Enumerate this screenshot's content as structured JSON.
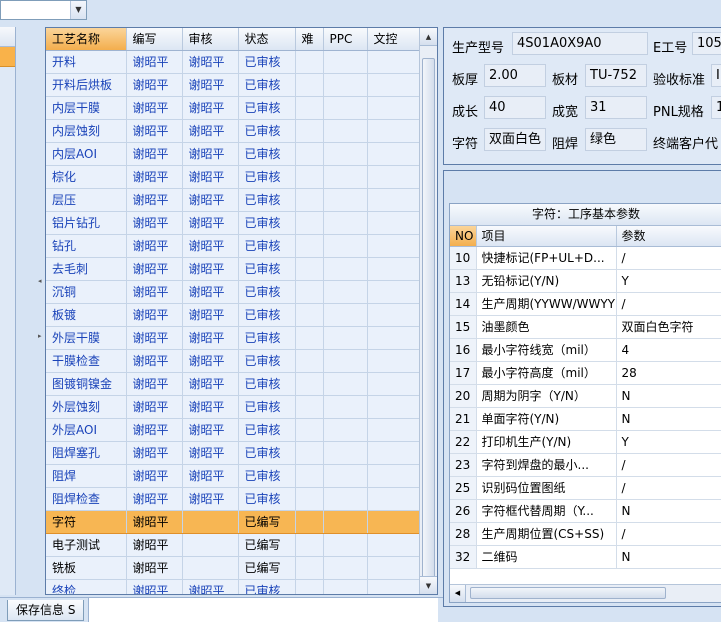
{
  "top_dropdown": {
    "value": "",
    "arrow_icon": "chevron-down-icon"
  },
  "process_grid": {
    "columns": [
      "工艺名称",
      "编写",
      "审核",
      "状态",
      "难",
      "PPC",
      "文控"
    ],
    "rows": [
      {
        "name": "开料",
        "writer": "谢昭平",
        "reviewer": "谢昭平",
        "status": "已审核"
      },
      {
        "name": "开料后烘板",
        "writer": "谢昭平",
        "reviewer": "谢昭平",
        "status": "已审核"
      },
      {
        "name": "内层干膜",
        "writer": "谢昭平",
        "reviewer": "谢昭平",
        "status": "已审核"
      },
      {
        "name": "内层蚀刻",
        "writer": "谢昭平",
        "reviewer": "谢昭平",
        "status": "已审核"
      },
      {
        "name": "内层AOI",
        "writer": "谢昭平",
        "reviewer": "谢昭平",
        "status": "已审核"
      },
      {
        "name": "棕化",
        "writer": "谢昭平",
        "reviewer": "谢昭平",
        "status": "已审核"
      },
      {
        "name": "层压",
        "writer": "谢昭平",
        "reviewer": "谢昭平",
        "status": "已审核"
      },
      {
        "name": "铝片钻孔",
        "writer": "谢昭平",
        "reviewer": "谢昭平",
        "status": "已审核"
      },
      {
        "name": "钻孔",
        "writer": "谢昭平",
        "reviewer": "谢昭平",
        "status": "已审核"
      },
      {
        "name": "去毛刺",
        "writer": "谢昭平",
        "reviewer": "谢昭平",
        "status": "已审核"
      },
      {
        "name": "沉铜",
        "writer": "谢昭平",
        "reviewer": "谢昭平",
        "status": "已审核"
      },
      {
        "name": "板镀",
        "writer": "谢昭平",
        "reviewer": "谢昭平",
        "status": "已审核"
      },
      {
        "name": "外层干膜",
        "writer": "谢昭平",
        "reviewer": "谢昭平",
        "status": "已审核"
      },
      {
        "name": "干膜检查",
        "writer": "谢昭平",
        "reviewer": "谢昭平",
        "status": "已审核"
      },
      {
        "name": "图镀铜镍金",
        "writer": "谢昭平",
        "reviewer": "谢昭平",
        "status": "已审核"
      },
      {
        "name": "外层蚀刻",
        "writer": "谢昭平",
        "reviewer": "谢昭平",
        "status": "已审核"
      },
      {
        "name": "外层AOI",
        "writer": "谢昭平",
        "reviewer": "谢昭平",
        "status": "已审核"
      },
      {
        "name": "阻焊塞孔",
        "writer": "谢昭平",
        "reviewer": "谢昭平",
        "status": "已审核"
      },
      {
        "name": "阻焊",
        "writer": "谢昭平",
        "reviewer": "谢昭平",
        "status": "已审核"
      },
      {
        "name": "阻焊检查",
        "writer": "谢昭平",
        "reviewer": "谢昭平",
        "status": "已审核"
      },
      {
        "name": "字符",
        "writer": "谢昭平",
        "reviewer": "",
        "status": "已编写"
      },
      {
        "name": "电子测试",
        "writer": "谢昭平",
        "reviewer": "",
        "status": "已编写"
      },
      {
        "name": "铣板",
        "writer": "谢昭平",
        "reviewer": "",
        "status": "已编写"
      },
      {
        "name": "终检",
        "writer": "谢昭平",
        "reviewer": "谢昭平",
        "status": "已审核"
      }
    ]
  },
  "bottom": {
    "save_tab": "保存信息 S"
  },
  "info": {
    "model_label": "生产型号",
    "model_value": "4S01A0X9A0",
    "e_label": "E工号",
    "e_value": "105",
    "thickness_label": "板厚",
    "thickness_value": "2.00",
    "material_label": "板材",
    "material_value": "TU-752",
    "standard_label": "验收标准",
    "standard_value": "I",
    "length_label": "成长",
    "length_value": "40",
    "width_label": "成宽",
    "width_value": "31",
    "pnl_label": "PNL规格",
    "pnl_value": "1",
    "char_label": "字符",
    "char_value": "双面白色",
    "mask_label": "阻焊",
    "mask_value": "绿色",
    "customer_label": "终端客户代"
  },
  "params": {
    "caption": "字符：工序基本参数",
    "columns": [
      "NO",
      "项目",
      "参数"
    ],
    "rows": [
      {
        "no": "10",
        "item": "快捷标记(FP+UL+D...",
        "value": "/"
      },
      {
        "no": "13",
        "item": "无铅标记(Y/N)",
        "value": "Y"
      },
      {
        "no": "14",
        "item": "生产周期(YYWW/WWYY)",
        "value": "/"
      },
      {
        "no": "15",
        "item": "油墨颜色",
        "value": "双面白色字符"
      },
      {
        "no": "16",
        "item": "最小字符线宽（mil）",
        "value": "4"
      },
      {
        "no": "17",
        "item": "最小字符高度（mil）",
        "value": "28"
      },
      {
        "no": "20",
        "item": "周期为阴字（Y/N）",
        "value": "N"
      },
      {
        "no": "21",
        "item": "单面字符(Y/N)",
        "value": "N"
      },
      {
        "no": "22",
        "item": "打印机生产(Y/N)",
        "value": "Y"
      },
      {
        "no": "23",
        "item": "字符到焊盘的最小...",
        "value": "/"
      },
      {
        "no": "25",
        "item": "识别码位置图纸",
        "value": "/"
      },
      {
        "no": "26",
        "item": "字符框代替周期（Y...",
        "value": "N"
      },
      {
        "no": "28",
        "item": "生产周期位置(CS+SS)",
        "value": "/"
      },
      {
        "no": "32",
        "item": "二维码",
        "value": "N"
      }
    ]
  }
}
